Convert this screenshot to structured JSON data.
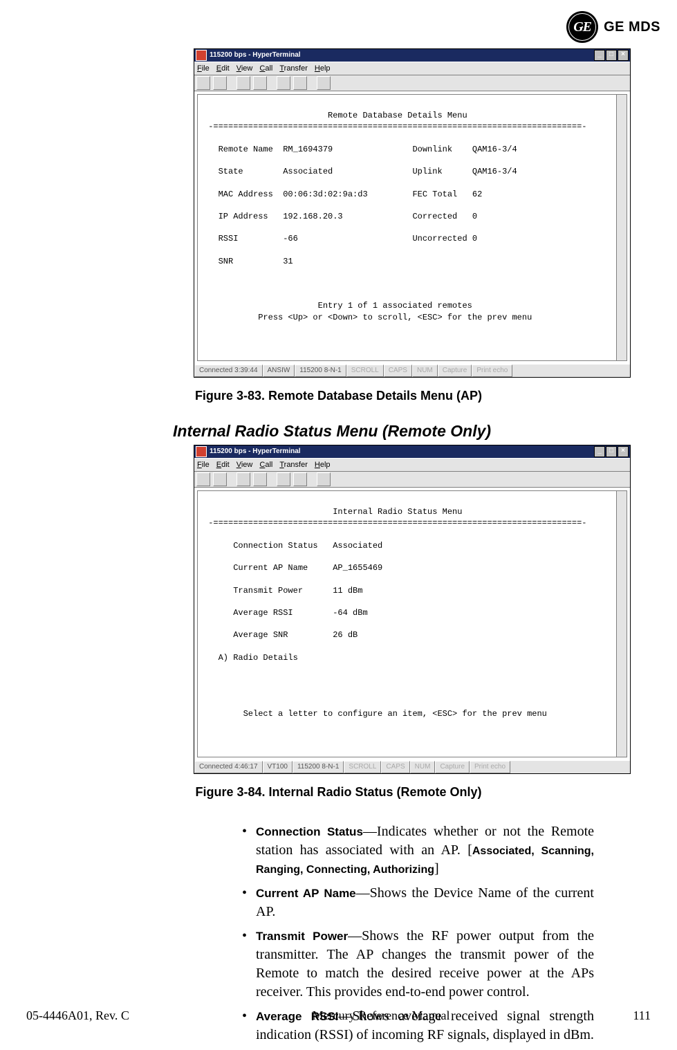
{
  "brand": {
    "badge": "GE",
    "text": "GE MDS"
  },
  "figure1": {
    "window_title": "115200 bps - HyperTerminal",
    "menus": [
      "File",
      "Edit",
      "View",
      "Call",
      "Transfer",
      "Help"
    ],
    "status": {
      "conn": "Connected 3:39:44",
      "emu": "ANSIW",
      "port": "115200 8-N-1",
      "dim": [
        "SCROLL",
        "CAPS",
        "NUM",
        "Capture",
        "Print echo"
      ]
    },
    "title": "Remote Database Details Menu",
    "rule": "-==========================================================================-",
    "left_labels": [
      "Remote Name",
      "State",
      "MAC Address",
      "IP Address",
      "RSSI",
      "SNR"
    ],
    "left_values": [
      "RM_1694379",
      "Associated",
      "00:06:3d:02:9a:d3",
      "192.168.20.3",
      "-66",
      "31"
    ],
    "right_labels": [
      "Downlink",
      "Uplink",
      "FEC Total",
      "Corrected",
      "Uncorrected"
    ],
    "right_values": [
      "QAM16-3/4",
      "QAM16-3/4",
      "62",
      "0",
      "0"
    ],
    "footer1": "Entry 1 of 1 associated remotes",
    "footer2": "Press <Up> or <Down> to scroll, <ESC> for the prev menu",
    "caption": "Figure 3-83. Remote Database Details Menu (AP)"
  },
  "section_title": "Internal Radio Status Menu (Remote Only)",
  "figure2": {
    "window_title": "115200 bps - HyperTerminal",
    "menus": [
      "File",
      "Edit",
      "View",
      "Call",
      "Transfer",
      "Help"
    ],
    "status": {
      "conn": "Connected 4:46:17",
      "emu": "VT100",
      "port": "115200 8-N-1",
      "dim": [
        "SCROLL",
        "CAPS",
        "NUM",
        "Capture",
        "Print echo"
      ]
    },
    "title": "Internal Radio Status Menu",
    "rule": "-==========================================================================-",
    "labels": [
      "Connection Status",
      "Current AP Name",
      "Transmit Power",
      "Average RSSI",
      "Average SNR"
    ],
    "values": [
      "Associated",
      "AP_1655469",
      "11 dBm",
      "-64 dBm",
      "26 dB"
    ],
    "option": "A) Radio Details",
    "footer": "Select a letter to configure an item, <ESC> for the prev menu",
    "caption": "Figure 3-84. Internal Radio Status (Remote Only)"
  },
  "bullets": [
    {
      "term": "Connection Status",
      "desc": "—Indicates whether or not the Remote station has associated with an AP. [",
      "opts": "Associated, Scanning, Ranging, Connecting, Authorizing",
      "tail": "]"
    },
    {
      "term": "Current AP Name",
      "desc": "—Shows the Device Name of the current AP."
    },
    {
      "term": "Transmit Power",
      "desc": "—Shows the RF power output from the transmitter. The AP changes the transmit power of the Remote to match the desired receive power at the APs receiver. This provides end-to-end power control."
    },
    {
      "term": "Average RSSI",
      "desc": "—Shows average received signal strength indication (RSSI) of incoming RF signals, displayed in dBm."
    }
  ],
  "footer": {
    "left": "05-4446A01, Rev. C",
    "center": "Mercury Reference Manual",
    "right": "111"
  }
}
